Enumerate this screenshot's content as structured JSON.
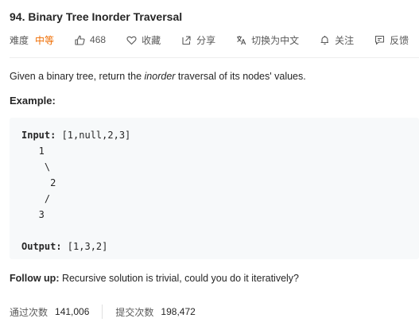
{
  "problem": {
    "title": "94. Binary Tree Inorder Traversal",
    "difficulty_label": "难度",
    "difficulty_value": "中等",
    "likes": "468",
    "favorite_label": "收藏",
    "share_label": "分享",
    "switch_lang_label": "切换为中文",
    "follow_label": "关注",
    "feedback_label": "反馈",
    "colors": {
      "difficulty": "#ef6c00",
      "code_bg": "#f7f9fa"
    },
    "icons": [
      "thumbs-up-icon",
      "heart-icon",
      "share-icon",
      "translate-icon",
      "bell-icon",
      "feedback-icon"
    ]
  },
  "description": {
    "before": "Given a binary tree, return the ",
    "emphasis": "inorder",
    "after": " traversal of its nodes' values."
  },
  "example": {
    "label": "Example:",
    "input_label": "Input:",
    "input_value": " [1,null,2,3]",
    "tree_lines": [
      "   1",
      "    \\",
      "     2",
      "    /",
      "   3"
    ],
    "output_label": "Output:",
    "output_value": " [1,3,2]"
  },
  "follow_up": {
    "label": "Follow up:",
    "text": " Recursive solution is trivial, could you do it iteratively?"
  },
  "stats": {
    "accepted_label": "通过次数",
    "accepted_value": "141,006",
    "submissions_label": "提交次数",
    "submissions_value": "198,472"
  }
}
